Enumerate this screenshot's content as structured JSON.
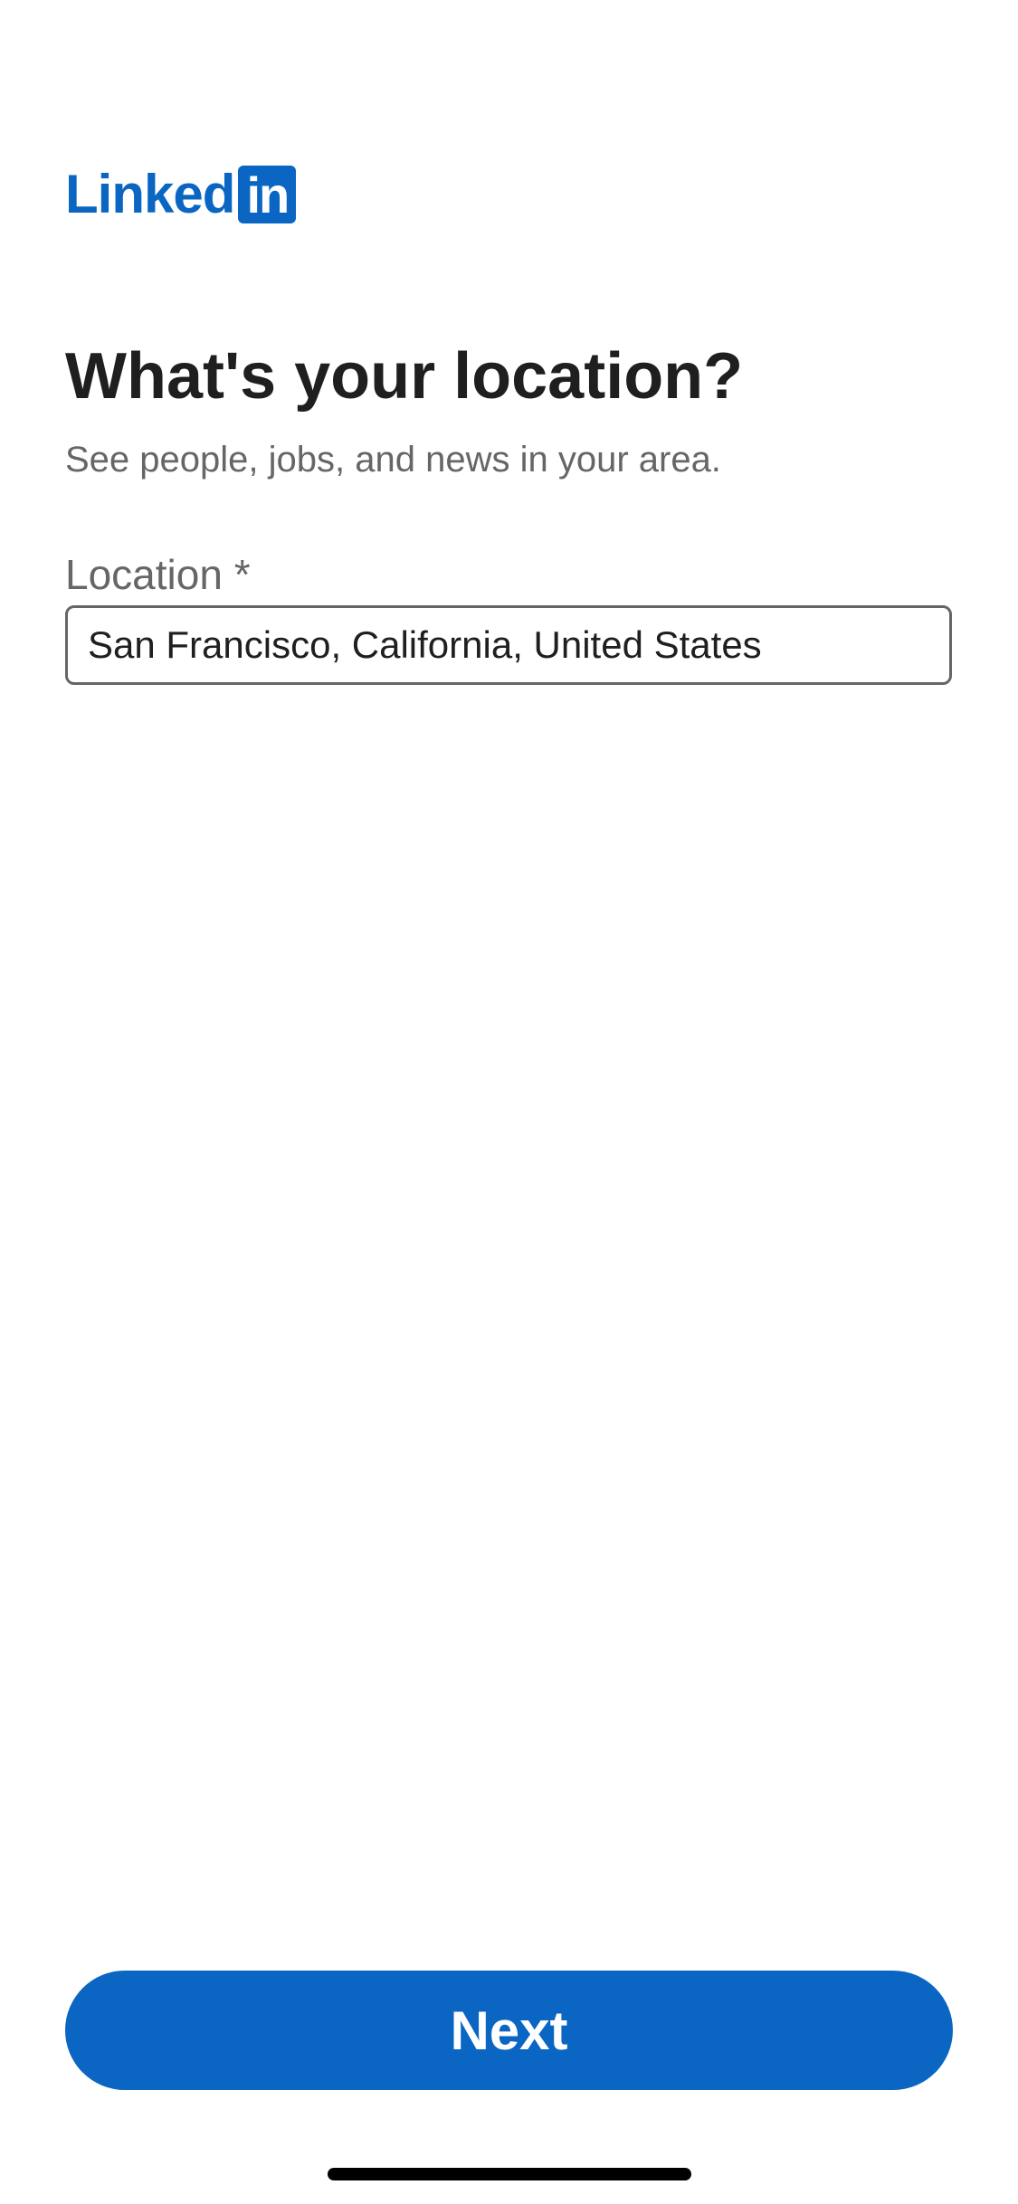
{
  "brand": {
    "logo_text": "Linked",
    "logo_box_text": "in",
    "color": "#0a66c2"
  },
  "header": {
    "title": "What's your location?",
    "subtitle": "See people, jobs, and news in your area."
  },
  "form": {
    "location_label": "Location *",
    "location_value": "San Francisco, California, United States"
  },
  "footer": {
    "next_label": "Next"
  }
}
